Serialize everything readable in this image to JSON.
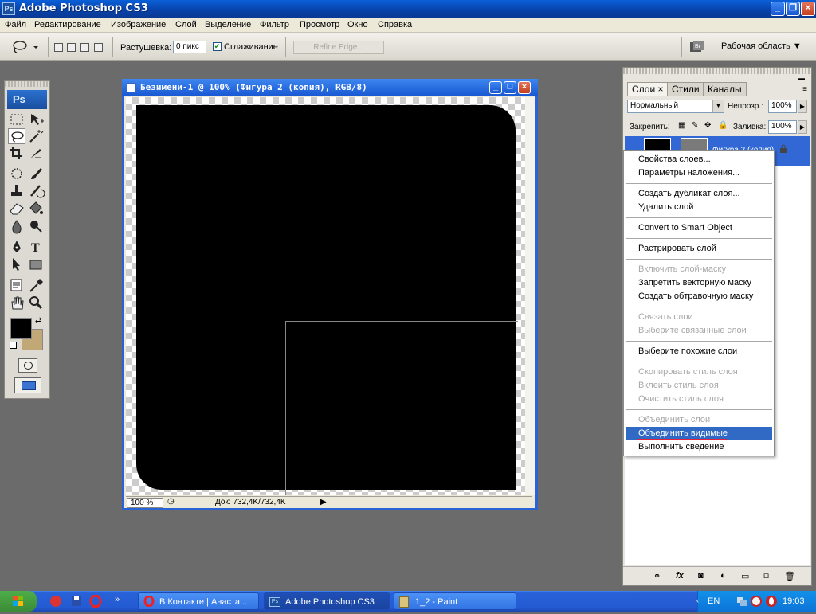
{
  "app": {
    "title": "Adobe Photoshop CS3",
    "icon_text": "Ps"
  },
  "menu": [
    "Файл",
    "Редактирование",
    "Изображение",
    "Слой",
    "Выделение",
    "Фильтр",
    "Просмотр",
    "Окно",
    "Справка"
  ],
  "options": {
    "feather_label": "Растушевка:",
    "feather_value": "0 пикс",
    "antialias_label": "Сглаживание",
    "antialias_checked": true,
    "refine_edge_label": "Refine Edge...",
    "workspace_label": "Рабочая область"
  },
  "tools": {
    "logo": "Ps",
    "foreground_color": "#000000",
    "background_color": "#c3a877"
  },
  "document": {
    "title": "Безимени-1 @ 100% (Фигура 2 (копия), RGB/8)",
    "zoom": "100 %",
    "doc_size": "Док: 732,4K/732,4K"
  },
  "layers_panel": {
    "tabs": [
      "Слои",
      "Стили",
      "Каналы"
    ],
    "blend_mode": "Нормальный",
    "opacity_label": "Непрозр.:",
    "opacity_value": "100%",
    "lock_label": "Закрепить:",
    "fill_label": "Заливка:",
    "fill_value": "100%",
    "selected_layer_name": "Фигура 2 (копия)"
  },
  "context_menu": {
    "items": [
      {
        "label": "Свойства слоев...",
        "enabled": true
      },
      {
        "label": "Параметры наложения...",
        "enabled": true
      },
      {
        "label": "Создать дубликат слоя...",
        "enabled": true
      },
      {
        "label": "Удалить слой",
        "enabled": true
      },
      {
        "label": "Convert to Smart Object",
        "enabled": true
      },
      {
        "label": "Растрировать слой",
        "enabled": true
      },
      {
        "label": "Включить слой-маску",
        "enabled": false
      },
      {
        "label": "Запретить векторную маску",
        "enabled": true
      },
      {
        "label": "Создать обтравочную маску",
        "enabled": true
      },
      {
        "label": "Связать слои",
        "enabled": false
      },
      {
        "label": "Выберите связанные слои",
        "enabled": false
      },
      {
        "label": "Выберите похожие слои",
        "enabled": true
      },
      {
        "label": "Скопировать стиль слоя",
        "enabled": false
      },
      {
        "label": "Вклеить стиль слоя",
        "enabled": false
      },
      {
        "label": "Очистить стиль слоя",
        "enabled": false
      },
      {
        "label": "Объединить слои",
        "enabled": false
      },
      {
        "label": "Объединить видимые",
        "enabled": true,
        "highlighted": true
      },
      {
        "label": "Выполнить сведение",
        "enabled": true
      }
    ]
  },
  "taskbar": {
    "buttons": [
      "В Контакте | Анаста...",
      "Adobe Photoshop CS3",
      "1_2 - Paint"
    ],
    "active_button": "Adobe Photoshop CS3",
    "language": "EN",
    "clock": "19:03"
  },
  "colors": {
    "accent": "#316ac5",
    "highlight_underline": "#e6233b",
    "workspace_bg": "#6b6b6b"
  }
}
